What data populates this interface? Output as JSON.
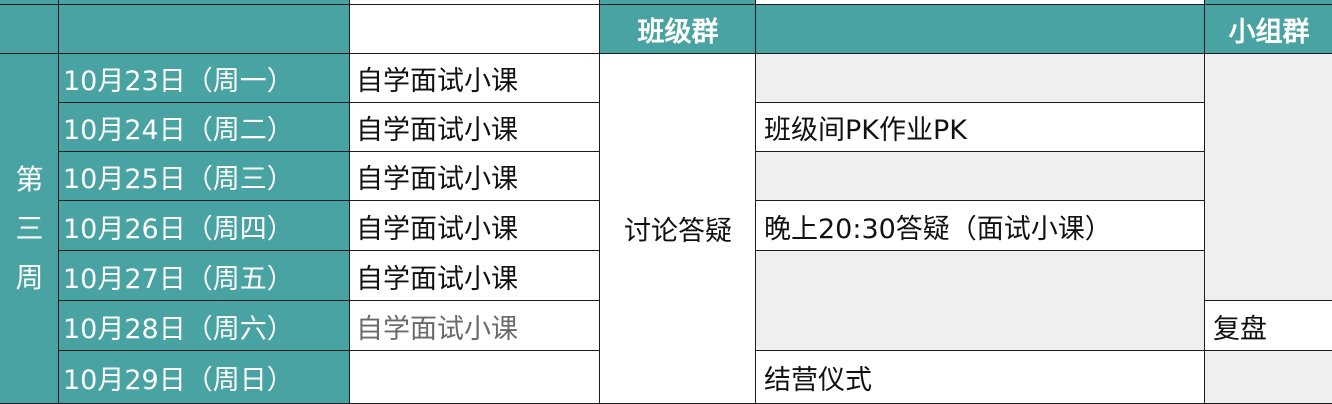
{
  "header": {
    "class_group": "班级群",
    "small_group": "小组群"
  },
  "week_label": [
    "第",
    "三",
    "周"
  ],
  "rows": [
    {
      "date": "10月23日（周一）",
      "course": "自学面试小课",
      "activity": ""
    },
    {
      "date": "10月24日（周二）",
      "course": "自学面试小课",
      "activity": "班级间PK作业PK"
    },
    {
      "date": "10月25日（周三）",
      "course": "自学面试小课",
      "activity": ""
    },
    {
      "date": "10月26日（周四）",
      "course": "自学面试小课",
      "activity": "晚上20:30答疑（面试小课）"
    },
    {
      "date": "10月27日（周五）",
      "course": "自学面试小课",
      "activity": ""
    },
    {
      "date": "10月28日（周六）",
      "course": "自学面试小课",
      "activity": ""
    },
    {
      "date": "10月29日（周日）",
      "course": "",
      "activity": "结营仪式"
    }
  ],
  "discussion": "讨论答疑",
  "review": "复盘",
  "colors": {
    "header_teal": "#4aa3a3",
    "gray_fill": "#efefef",
    "border": "#1d1d1d"
  }
}
